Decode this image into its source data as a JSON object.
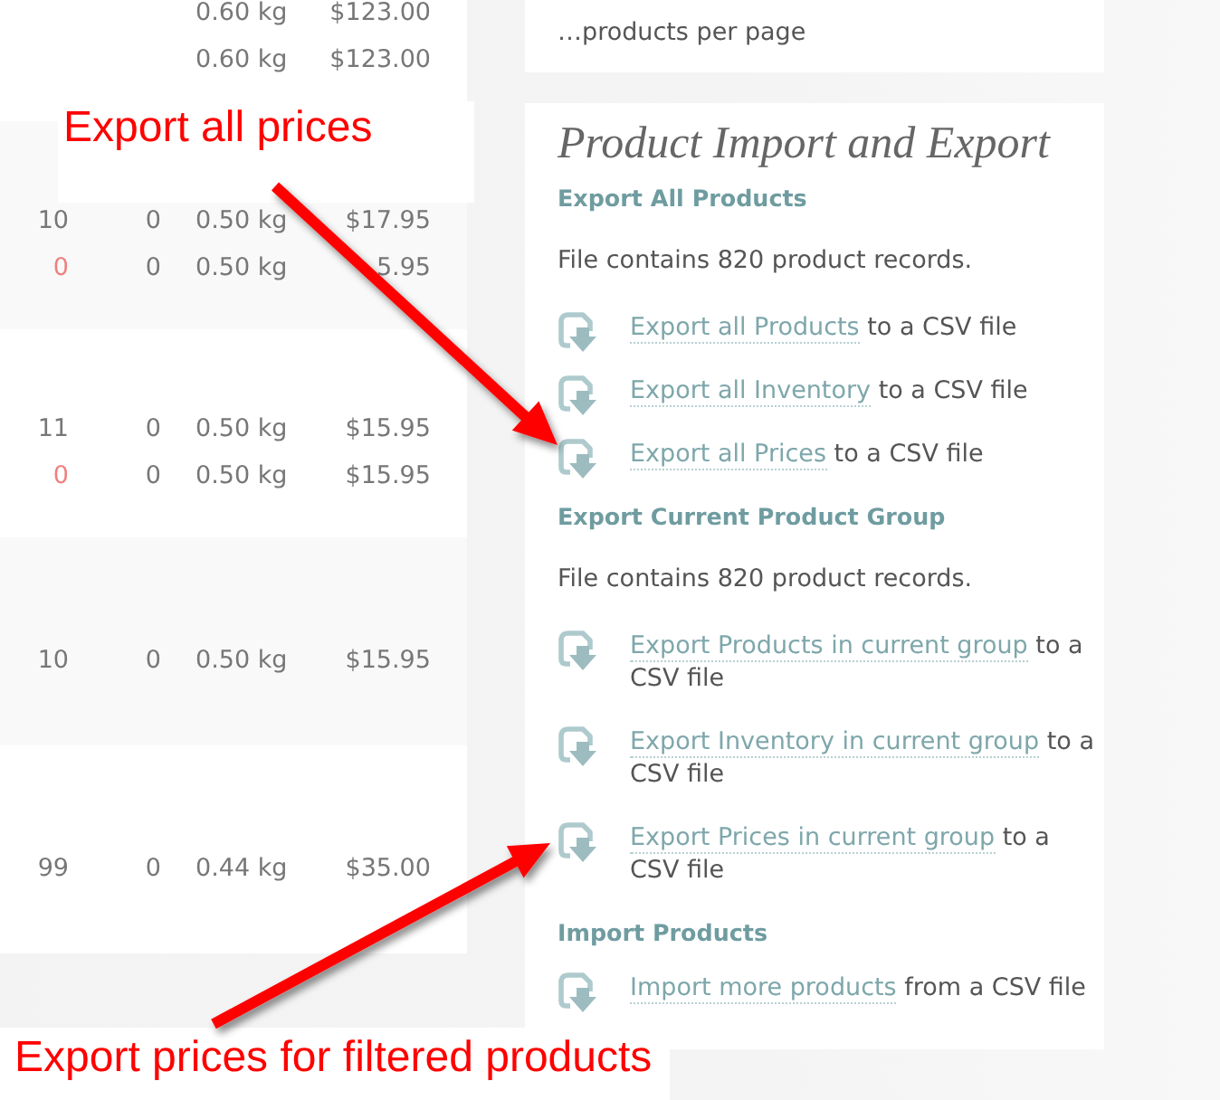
{
  "product_table": {
    "groups": [
      {
        "rows": [
          {
            "weight": "0.60 kg",
            "price": "$123.00"
          },
          {
            "weight": "0.60 kg",
            "price": "$123.00"
          }
        ]
      },
      {
        "rows": [
          {
            "column_1": "10",
            "warning": false,
            "column_2": "0",
            "weight": "0.50 kg",
            "price": "$17.95"
          },
          {
            "column_1": "0",
            "warning": true,
            "column_2": "0",
            "weight": "0.50 kg",
            "price": "5.95"
          }
        ]
      },
      {
        "rows": [
          {
            "column_1": "11",
            "warning": false,
            "column_2": "0",
            "weight": "0.50 kg",
            "price": "$15.95"
          },
          {
            "column_1": "0",
            "warning": true,
            "column_2": "0",
            "weight": "0.50 kg",
            "price": "$15.95"
          }
        ]
      },
      {
        "rows": [
          {
            "column_1": "10",
            "warning": false,
            "column_2": "0",
            "weight": "0.50 kg",
            "price": "$15.95"
          }
        ]
      },
      {
        "rows": [
          {
            "column_1": "99",
            "warning": false,
            "column_2": "0",
            "weight": "0.44 kg",
            "price": "$35.00"
          }
        ]
      }
    ]
  },
  "settings_card": {
    "text": "…products per page"
  },
  "import_export": {
    "title": "Product Import and Export",
    "sections": [
      {
        "heading": "Export All Products",
        "note": "File contains 820 product records.",
        "items": [
          {
            "link": "Export all Products",
            "text": "to a CSV file"
          },
          {
            "link": "Export all Inventory",
            "text": "to a CSV file"
          },
          {
            "link": "Export all Prices",
            "text": "to a CSV file"
          }
        ]
      },
      {
        "heading": "Export Current Product Group",
        "note": "File contains 820 product records.",
        "items": [
          {
            "link": "Export Products in current group",
            "text": "to a CSV file"
          },
          {
            "link": "Export Inventory in current group",
            "text": "to a CSV file"
          },
          {
            "link": "Export Prices in current group",
            "text": "to a CSV file"
          }
        ]
      },
      {
        "heading": "Import Products",
        "items": [
          {
            "link": "Import more products",
            "text": "from a CSV file"
          }
        ]
      }
    ]
  },
  "annotations": [
    {
      "text": "Export all prices"
    },
    {
      "text": "Export prices for filtered products"
    }
  ]
}
